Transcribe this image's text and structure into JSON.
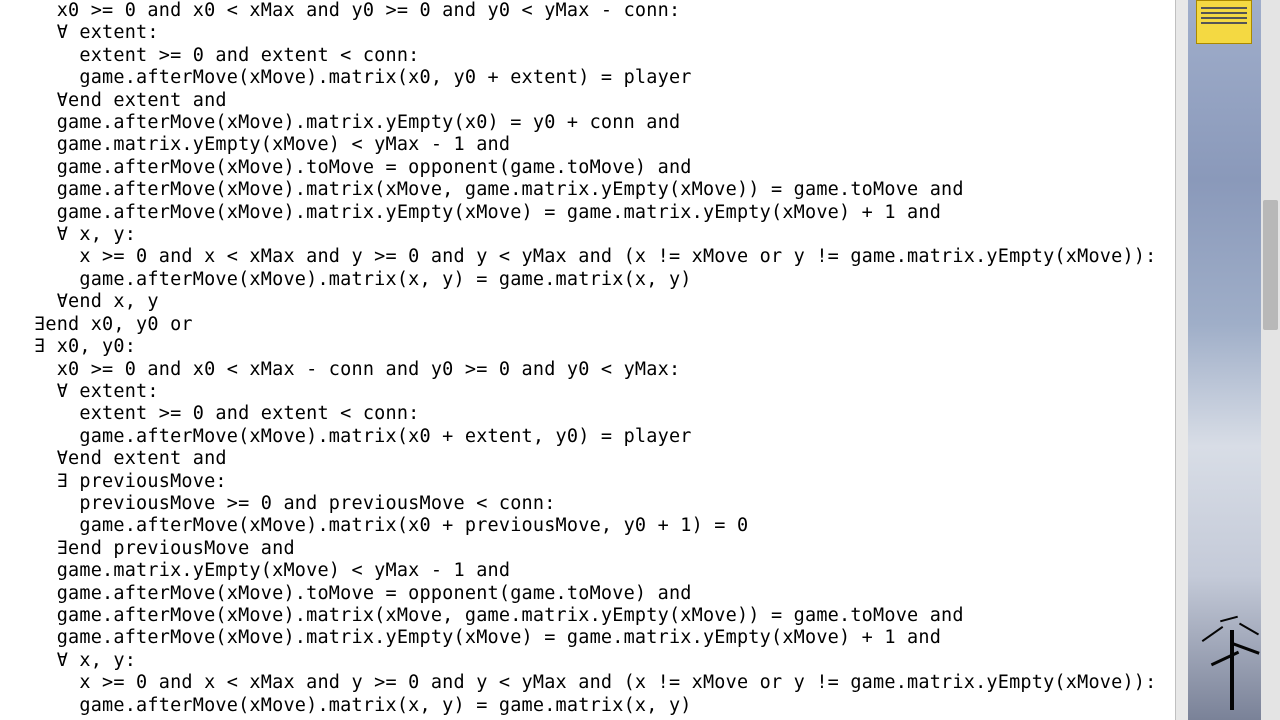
{
  "code": {
    "lines": [
      "     x0 >= 0 and x0 < xMax and y0 >= 0 and y0 < yMax - conn:",
      "     ∀ extent:",
      "       extent >= 0 and extent < conn:",
      "       game.afterMove(xMove).matrix(x0, y0 + extent) = player",
      "     ∀end extent and",
      "     game.afterMove(xMove).matrix.yEmpty(x0) = y0 + conn and",
      "     game.matrix.yEmpty(xMove) < yMax - 1 and",
      "     game.afterMove(xMove).toMove = opponent(game.toMove) and",
      "     game.afterMove(xMove).matrix(xMove, game.matrix.yEmpty(xMove)) = game.toMove and",
      "     game.afterMove(xMove).matrix.yEmpty(xMove) = game.matrix.yEmpty(xMove) + 1 and",
      "     ∀ x, y:",
      "       x >= 0 and x < xMax and y >= 0 and y < yMax and (x != xMove or y != game.matrix.yEmpty(xMove)):",
      "       game.afterMove(xMove).matrix(x, y) = game.matrix(x, y)",
      "     ∀end x, y",
      "   ∃end x0, y0 or",
      "   ∃ x0, y0:",
      "     x0 >= 0 and x0 < xMax - conn and y0 >= 0 and y0 < yMax:",
      "     ∀ extent:",
      "       extent >= 0 and extent < conn:",
      "       game.afterMove(xMove).matrix(x0 + extent, y0) = player",
      "     ∀end extent and",
      "     ∃ previousMove:",
      "       previousMove >= 0 and previousMove < conn:",
      "       game.afterMove(xMove).matrix(x0 + previousMove, y0 + 1) = 0",
      "     ∃end previousMove and",
      "     game.matrix.yEmpty(xMove) < yMax - 1 and",
      "     game.afterMove(xMove).toMove = opponent(game.toMove) and",
      "     game.afterMove(xMove).matrix(xMove, game.matrix.yEmpty(xMove)) = game.toMove and",
      "     game.afterMove(xMove).matrix.yEmpty(xMove) = game.matrix.yEmpty(xMove) + 1 and",
      "     ∀ x, y:",
      "       x >= 0 and x < xMax and y >= 0 and y < yMax and (x != xMove or y != game.matrix.yEmpty(xMove)):",
      "       game.afterMove(xMove).matrix(x, y) = game.matrix(x, y)"
    ]
  }
}
